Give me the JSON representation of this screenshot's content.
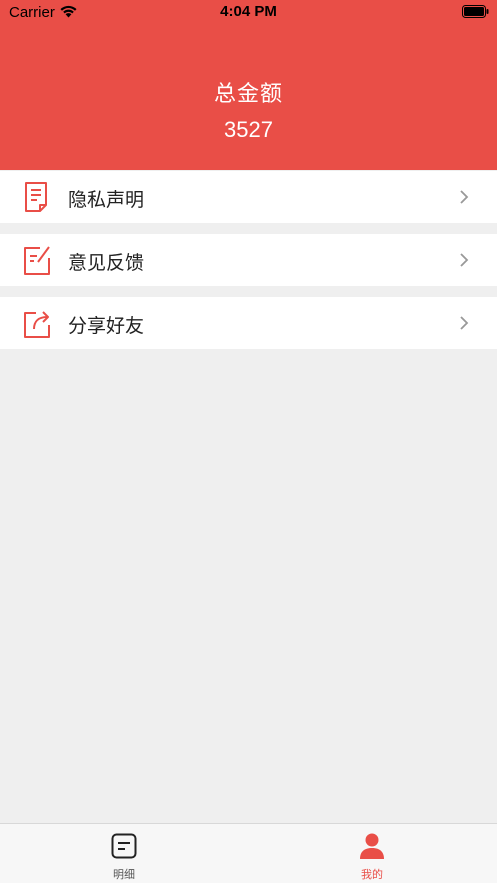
{
  "status_bar": {
    "carrier": "Carrier",
    "time": "4:04 PM"
  },
  "header": {
    "title": "总金额",
    "total": "3527"
  },
  "menu": [
    {
      "label": "隐私声明",
      "icon": "document-icon"
    },
    {
      "label": "意见反馈",
      "icon": "edit-icon"
    },
    {
      "label": "分享好友",
      "icon": "share-icon"
    }
  ],
  "tabbar": {
    "tabs": [
      {
        "label": "明细",
        "icon": "list-icon",
        "active": false
      },
      {
        "label": "我的",
        "icon": "person-icon",
        "active": true
      }
    ]
  },
  "colors": {
    "accent": "#e94e47",
    "background": "#efefef",
    "tab_inactive": "#555555"
  }
}
